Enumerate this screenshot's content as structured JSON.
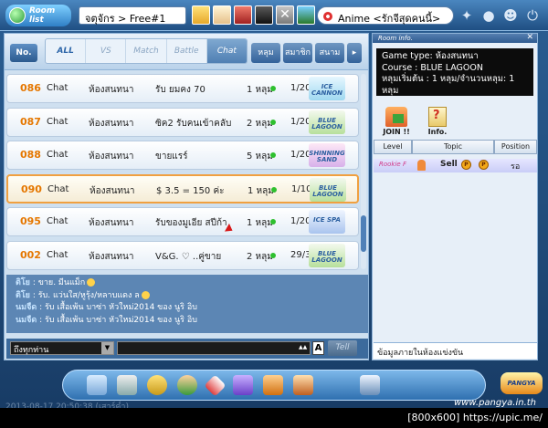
{
  "topbar": {
    "logo_label": "Room list",
    "breadcrumb": "จตุจักร > Free#1",
    "channel_label": "Anime <รักจีสุดคนนี้>",
    "close_glyph": "✕"
  },
  "filters": {
    "no_label": "No.",
    "items": [
      "ALL",
      "VS",
      "Match",
      "Battle",
      "Chat"
    ],
    "sort_tabs": [
      "หลุม",
      "สมาชิก",
      "สนาม"
    ],
    "next_arrow": "▸"
  },
  "rooms": [
    {
      "num": "086",
      "type": "Chat",
      "level": "ห้องสนทนา",
      "title": "รับ ยมคง  70",
      "holes": "1 หลุม",
      "count": "1/20",
      "course": "ICE CANNON",
      "selected": false
    },
    {
      "num": "087",
      "type": "Chat",
      "level": "ห้องสนทนา",
      "title": "ซิค2 รับคนเข้าคลับ",
      "holes": "2 หลุม",
      "count": "1/20",
      "course": "BLUE LAGOON",
      "selected": false
    },
    {
      "num": "088",
      "type": "Chat",
      "level": "ห้องสนทนา",
      "title": "ขายแรร์",
      "holes": "5 หลุม",
      "count": "1/20",
      "course": "SHINNING SAND",
      "selected": false
    },
    {
      "num": "090",
      "type": "Chat",
      "level": "ห้องสนทนา",
      "title": "$ 3.5 = 150 ค่ะ",
      "holes": "1 หลุม",
      "count": "1/10",
      "course": "BLUE LAGOON",
      "selected": true
    },
    {
      "num": "095",
      "type": "Chat",
      "level": "ห้องสนทนา",
      "title": "รับของมูเอีย สปีก้า",
      "holes": "1 หลุม",
      "count": "1/20",
      "course": "ICE SPA",
      "selected": false
    },
    {
      "num": "002",
      "type": "Chat",
      "level": "ห้องสนทนา",
      "title": "V&G. ♡ ..คู่ขาย",
      "holes": "2 หลุม",
      "count": "29/30",
      "course": "BLUE LAGOON",
      "selected": false
    }
  ],
  "chatlog": [
    {
      "name": "ติโย",
      "text": ": ขาย. มีนแม็ก"
    },
    {
      "name": "ติโย",
      "text": ": รับ. แว่นใส/หูรุ้ง/หลาบแดง ล"
    },
    {
      "name": "นมจืด",
      "text": ": รับ เสื้อเพ้น บาซ่า หัวใหม่2014 ของ นูริ อิบ"
    },
    {
      "name": "นมจืด",
      "text": ": รับ เสื้อเพ้น บาซ่า หัวใหม่2014 ของ นูริ อิบ"
    }
  ],
  "chatbar": {
    "target": "ถึงทุกท่าน",
    "dropdown_glyph": "▼",
    "size_glyph": "▲▲",
    "font_btn": "A",
    "tell_btn": "Tell"
  },
  "room_info": {
    "header": "Room info.",
    "close": "✕",
    "game_type": "Game type: ห้องสนทนา",
    "course": "Course : BLUE LAGOON",
    "holes": "หลุมเริ่มต้น : 1 หลุม/จำนวนหลุม: 1 หลุม",
    "join_label": "JOIN !!",
    "info_label": "Info.",
    "columns": [
      "Level",
      "Topic",
      "Position"
    ],
    "member": {
      "level": "Rookie F",
      "topic": "Sell",
      "p1": "P",
      "p2": "P",
      "position": "รอ"
    },
    "status": "ข้อมูลภายในห้องแข่งขัน"
  },
  "bottom": {
    "timestamp": "2013-08-17 20:50:38 (เสาร์ค่ำ)",
    "logo": "PANGYA",
    "site": "www.pangya.in.th",
    "footer": "[800x600] https://upic.me/"
  }
}
